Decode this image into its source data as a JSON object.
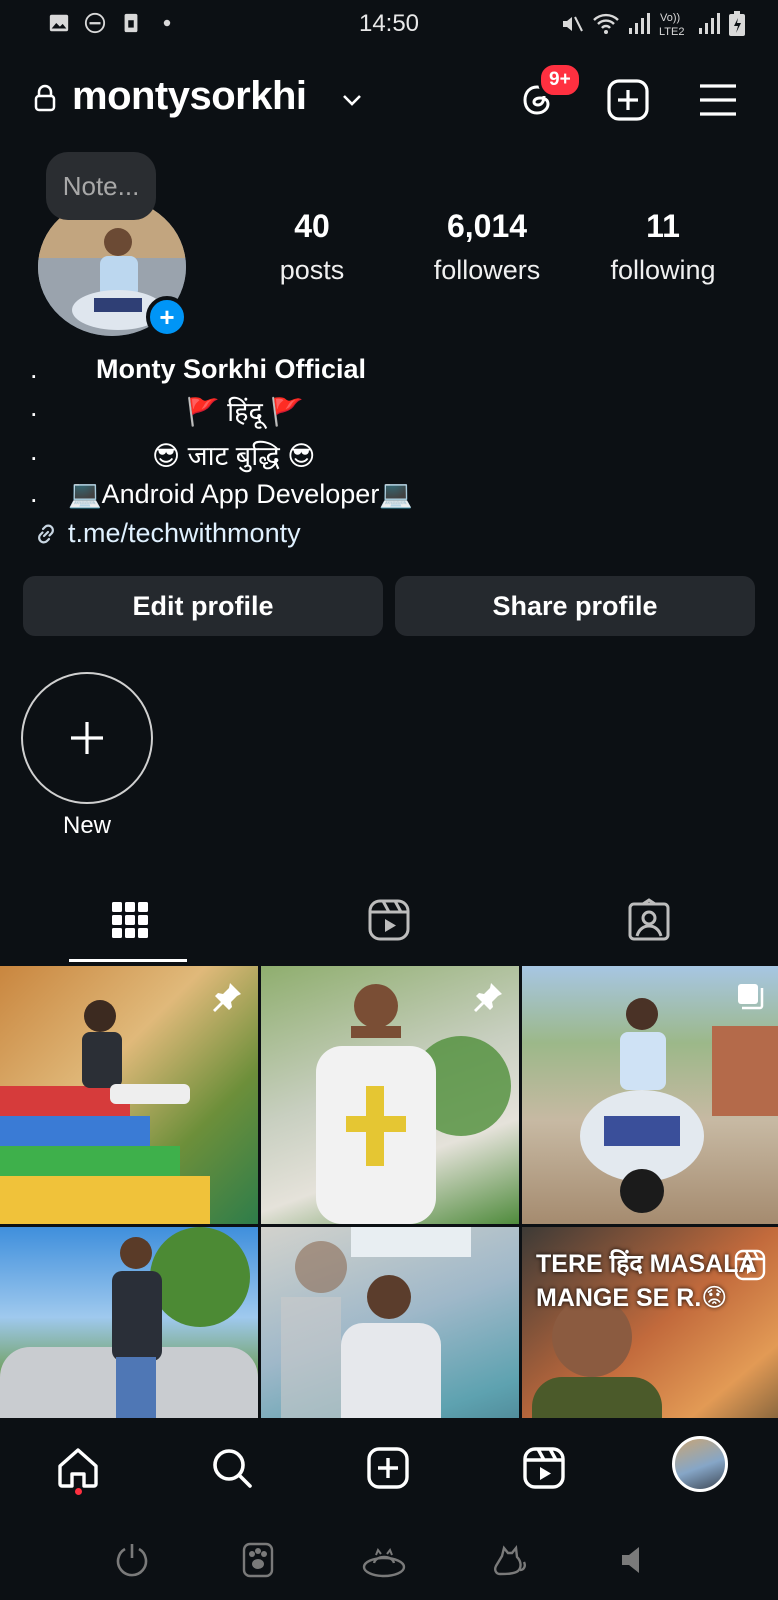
{
  "status_bar": {
    "time": "14:50",
    "left_icons": [
      "gallery-icon",
      "do-not-disturb-icon",
      "sim-icon",
      "dot-icon"
    ],
    "right_icons": [
      "mute-icon",
      "wifi-icon",
      "signal-icon",
      "volte-icon",
      "signal-icon",
      "battery-icon"
    ]
  },
  "header": {
    "username": "montysorkhi",
    "threads_badge": "9+"
  },
  "profile": {
    "note_placeholder": "Note...",
    "stats": [
      {
        "value": "40",
        "label": "posts"
      },
      {
        "value": "6,014",
        "label": "followers"
      },
      {
        "value": "11",
        "label": "following"
      }
    ],
    "bio": {
      "dots": [
        ".",
        ".",
        ".",
        "."
      ],
      "name": "Monty Sorkhi Official",
      "line2": "🚩 हिंदू 🚩",
      "line3": "😎 जाट बुद्धि 😎",
      "line4": "💻Android App Developer💻",
      "link": "t.me/techwithmonty"
    },
    "buttons": {
      "edit": "Edit profile",
      "share": "Share profile"
    },
    "highlight_new_label": "New"
  },
  "tabs": [
    "grid-icon",
    "reels-icon",
    "tagged-icon"
  ],
  "grid": {
    "posts": [
      {
        "pinned": true,
        "caption": ""
      },
      {
        "pinned": true,
        "caption": ""
      },
      {
        "pinned": false,
        "caption": "",
        "multi": true
      },
      {
        "pinned": false,
        "caption": ""
      },
      {
        "pinned": false,
        "caption": ""
      },
      {
        "pinned": false,
        "caption_line1": "TERE हिंद MASALA",
        "caption_line2": "MANGE SE R.😟",
        "reel": true
      }
    ]
  },
  "bottom_nav": [
    "home-icon",
    "search-icon",
    "create-icon",
    "reels-icon",
    "profile-avatar"
  ],
  "system_nav": [
    "power-icon",
    "paw-icon",
    "cat-bed-icon",
    "cat-icon",
    "volume-icon"
  ]
}
